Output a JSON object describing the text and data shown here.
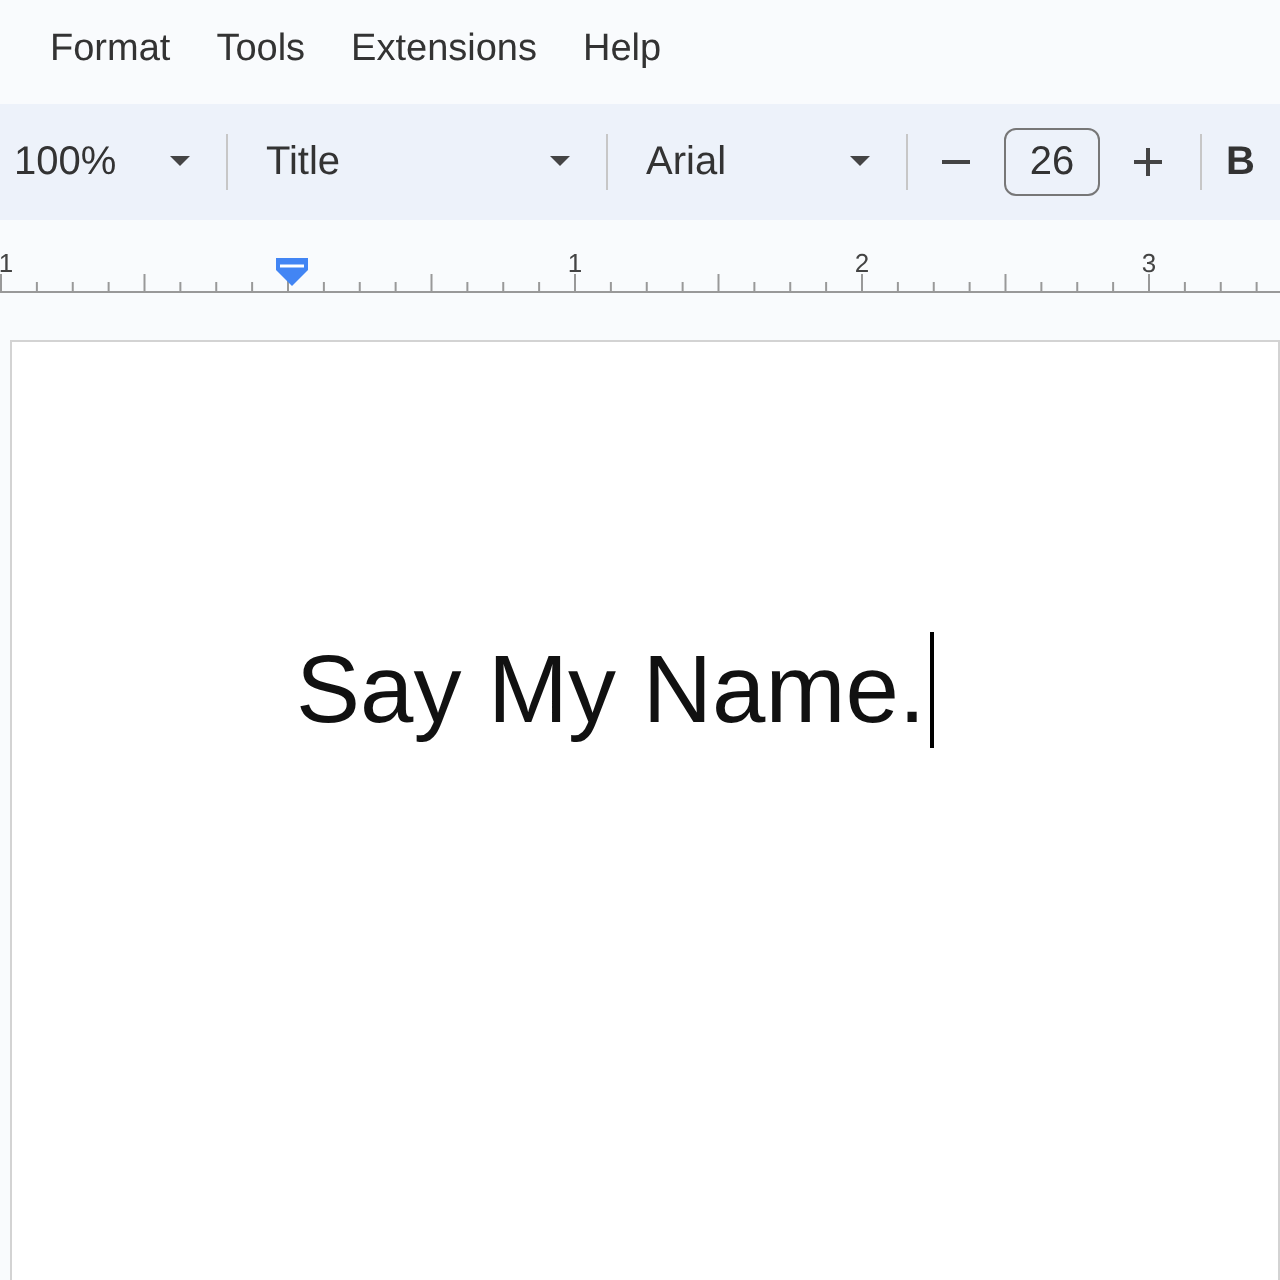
{
  "menu": [
    {
      "label": "Format"
    },
    {
      "label": "Tools"
    },
    {
      "label": "Extensions"
    },
    {
      "label": "Help"
    }
  ],
  "toolbar": {
    "zoom": "100%",
    "style": "Title",
    "font": "Arial",
    "font_size": "26",
    "bold": "B"
  },
  "ruler": {
    "labels": [
      "1",
      "1",
      "2",
      "3"
    ]
  },
  "document": {
    "text": "Say My Name.",
    "cursor": true
  }
}
